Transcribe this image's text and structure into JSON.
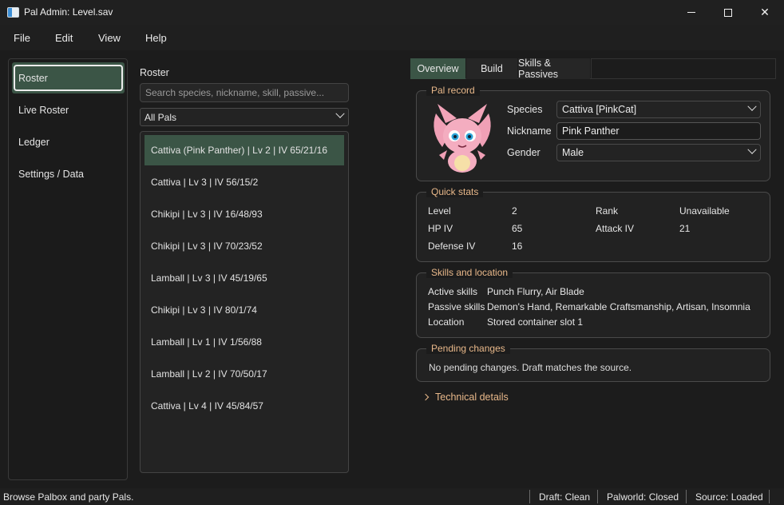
{
  "window": {
    "title": "Pal Admin: Level.sav"
  },
  "menu": [
    "File",
    "Edit",
    "View",
    "Help"
  ],
  "nav": {
    "items": [
      "Roster",
      "Live Roster",
      "Ledger",
      "Settings / Data"
    ],
    "active": "Roster"
  },
  "roster": {
    "label": "Roster",
    "search_placeholder": "Search species, nickname, skill, passive...",
    "filter": "All Pals",
    "rows": [
      "Cattiva (Pink Panther)  |  Lv 2  |  IV 65/21/16",
      "Cattiva  |  Lv 3  |  IV 56/15/2",
      "Chikipi  |  Lv 3  |  IV 16/48/93",
      "Chikipi  |  Lv 3  |  IV 70/23/52",
      "Lamball  |  Lv 3  |  IV 45/19/65",
      "Chikipi  |  Lv 3  |  IV 80/1/74",
      "Lamball  |  Lv 1  |  IV 1/56/88",
      "Lamball  |  Lv 2  |  IV 70/50/17",
      "Cattiva  |  Lv 4  |  IV 45/84/57"
    ]
  },
  "tabs": [
    "Overview",
    "Build",
    "Skills & Passives"
  ],
  "pal_record": {
    "title": "Pal record",
    "species_label": "Species",
    "species": "Cattiva  [PinkCat]",
    "nickname_label": "Nickname",
    "nickname": "Pink Panther",
    "gender_label": "Gender",
    "gender": "Male"
  },
  "quick_stats": {
    "title": "Quick stats",
    "level_label": "Level",
    "level": "2",
    "rank_label": "Rank",
    "rank": "Unavailable",
    "hp_label": "HP IV",
    "hp": "65",
    "attack_label": "Attack IV",
    "attack": "21",
    "defense_label": "Defense IV",
    "defense": "16"
  },
  "skills": {
    "title": "Skills and location",
    "active_label": "Active skills",
    "active": "Punch Flurry, Air Blade",
    "passive_label": "Passive skills",
    "passive": "Demon's Hand, Remarkable Craftsmanship, Artisan, Insomnia",
    "location_label": "Location",
    "location": "Stored container slot 1"
  },
  "pending": {
    "title": "Pending changes",
    "text": "No pending changes. Draft matches the source."
  },
  "technical": "Technical details",
  "status": {
    "hint": "Browse Palbox and party Pals.",
    "draft": "Draft: Clean",
    "palworld": "Palworld: Closed",
    "source": "Source: Loaded"
  },
  "colors": {
    "accent": "#3b5546",
    "section_title": "#e8b88a"
  }
}
